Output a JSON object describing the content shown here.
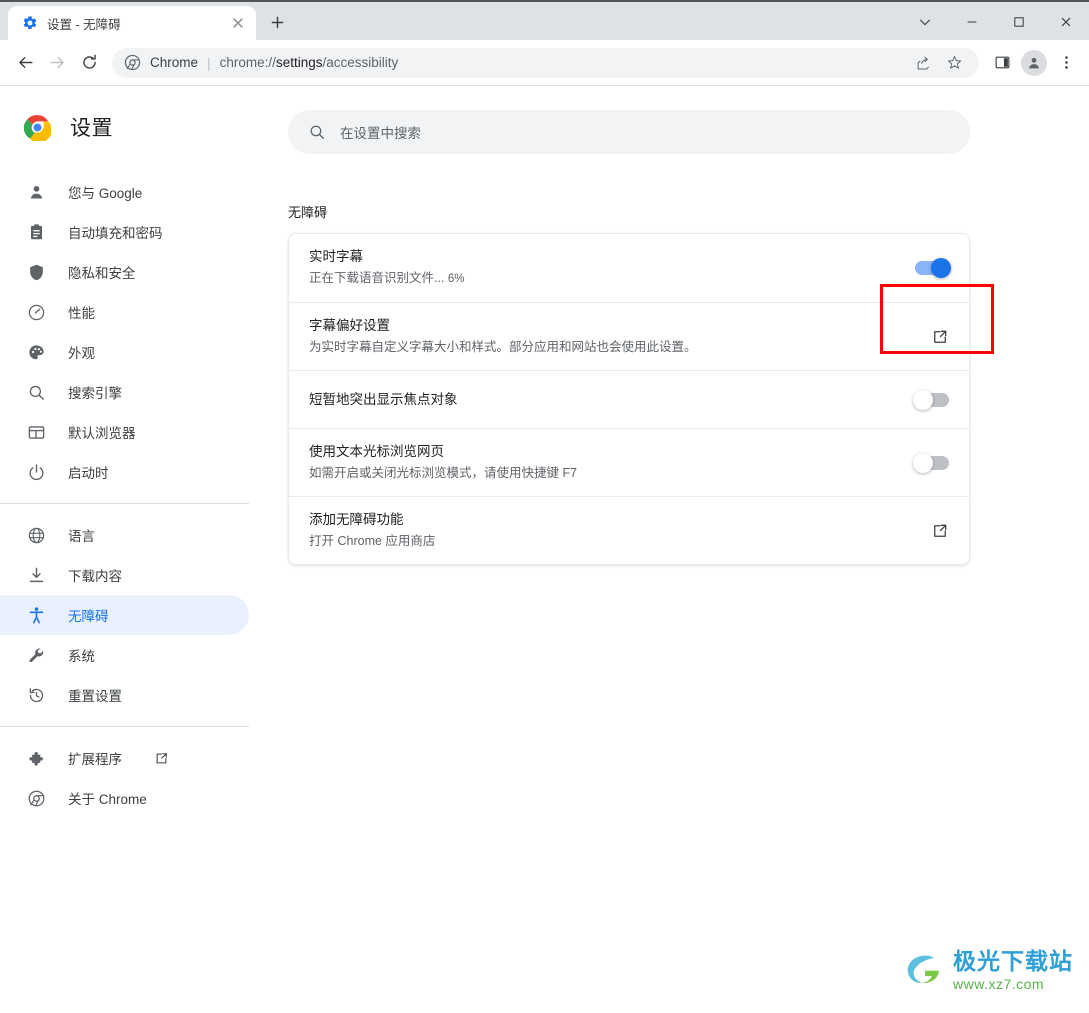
{
  "window": {
    "tab": {
      "title": "设置 - 无障碍",
      "favicon": "gear-icon",
      "close": "×"
    },
    "new_tab_label": "+",
    "controls": {
      "minimize": "−",
      "maximize": "□",
      "close": "✕",
      "tabsearch": "⌄"
    }
  },
  "toolbar": {
    "back": "←",
    "forward": "→",
    "reload": "⟳",
    "chip": "Chrome",
    "separator": "|",
    "url_prefix": "chrome://",
    "url_strong": "settings",
    "url_suffix": "/accessibility",
    "share_icon": "share-icon",
    "bookmark_icon": "star-icon",
    "sidepanel_icon": "side-panel-icon",
    "profile_icon": "profile-avatar-icon",
    "menu_icon": "three-dot-menu-icon"
  },
  "sidebar": {
    "brand": "设置",
    "groups": [
      {
        "items": [
          {
            "label": "您与 Google",
            "icon": "person-icon"
          },
          {
            "label": "自动填充和密码",
            "icon": "clipboard-icon"
          },
          {
            "label": "隐私和安全",
            "icon": "shield-icon"
          },
          {
            "label": "性能",
            "icon": "speedometer-icon"
          },
          {
            "label": "外观",
            "icon": "palette-icon"
          },
          {
            "label": "搜索引擎",
            "icon": "search-icon"
          },
          {
            "label": "默认浏览器",
            "icon": "browser-window-icon"
          },
          {
            "label": "启动时",
            "icon": "power-icon"
          }
        ]
      },
      {
        "items": [
          {
            "label": "语言",
            "icon": "globe-icon"
          },
          {
            "label": "下载内容",
            "icon": "download-icon"
          },
          {
            "label": "无障碍",
            "icon": "accessibility-icon",
            "active": true
          },
          {
            "label": "系统",
            "icon": "wrench-icon"
          },
          {
            "label": "重置设置",
            "icon": "history-restore-icon"
          }
        ]
      },
      {
        "items": [
          {
            "label": "扩展程序",
            "icon": "puzzle-icon",
            "external": true
          },
          {
            "label": "关于 Chrome",
            "icon": "chrome-icon"
          }
        ]
      }
    ]
  },
  "search": {
    "placeholder": "在设置中搜索",
    "icon": "search-icon"
  },
  "main": {
    "section_title": "无障碍",
    "rows": [
      {
        "title": "实时字幕",
        "subtitle": "正在下载语音识别文件...",
        "subtitle_pct": "6%",
        "control": "toggle",
        "state": "on"
      },
      {
        "title": "字幕偏好设置",
        "subtitle": "为实时字幕自定义字幕大小和样式。部分应用和网站也会使用此设置。",
        "control": "external-link",
        "state": ""
      },
      {
        "title": "短暂地突出显示焦点对象",
        "subtitle": "",
        "control": "toggle",
        "state": "off"
      },
      {
        "title": "使用文本光标浏览网页",
        "subtitle": "如需开启或关闭光标浏览模式，请使用快捷键 F7",
        "control": "toggle",
        "state": "off"
      },
      {
        "title": "添加无障碍功能",
        "subtitle": "打开 Chrome 应用商店",
        "control": "external-link",
        "state": ""
      }
    ]
  },
  "annotation": {
    "color": "#ff0000",
    "target": "live-caption-toggle"
  },
  "watermark": {
    "main": "极光下载站",
    "sub": "www.xz7.com",
    "accent": "#2f9fd8",
    "accent2": "#59b24a"
  },
  "colors": {
    "accent": "#1a73e8",
    "toggle_on_track": "#8ab4f8",
    "toggle_off_track": "#bdc1c6",
    "sidebar_active_bg": "#e8f0fe"
  }
}
